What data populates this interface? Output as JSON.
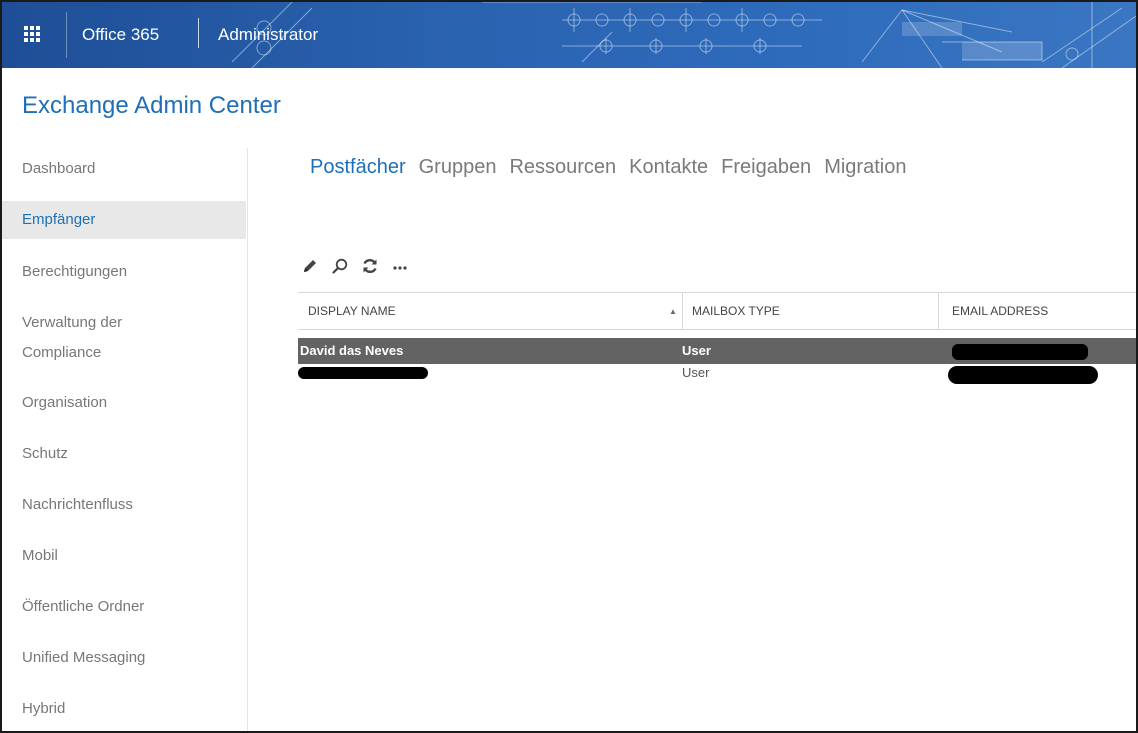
{
  "topbar": {
    "brand": "Office 365",
    "role": "Administrator"
  },
  "app_title": "Exchange Admin Center",
  "sidebar": {
    "items": [
      {
        "label": "Dashboard"
      },
      {
        "label": "Empfänger",
        "active": true
      },
      {
        "label": "Berechtigungen"
      },
      {
        "label_line1": "Verwaltung der",
        "label_line2": "Compliance"
      },
      {
        "label": "Organisation"
      },
      {
        "label": "Schutz"
      },
      {
        "label": "Nachrichtenfluss"
      },
      {
        "label": "Mobil"
      },
      {
        "label": "Öffentliche Ordner"
      },
      {
        "label": "Unified Messaging"
      },
      {
        "label": "Hybrid"
      }
    ]
  },
  "tabs": [
    {
      "label": "Postfächer",
      "active": true
    },
    {
      "label": "Gruppen"
    },
    {
      "label": "Ressourcen"
    },
    {
      "label": "Kontakte"
    },
    {
      "label": "Freigaben"
    },
    {
      "label": "Migration"
    }
  ],
  "toolbar": {
    "icons": [
      "edit-icon",
      "search-icon",
      "refresh-icon",
      "more-icon"
    ],
    "more_label": "..."
  },
  "table": {
    "columns": [
      "DISPLAY NAME",
      "MAILBOX TYPE",
      "EMAIL ADDRESS"
    ],
    "sort_indicator": "▲",
    "rows": [
      {
        "display_name": "David das Neves",
        "mailbox_type": "User",
        "selected": true
      },
      {
        "display_name": "",
        "mailbox_type": "User",
        "selected": false
      }
    ]
  },
  "colors": {
    "accent": "#1e6fb8",
    "topbar": "#2a63b0",
    "selected_row": "#636363"
  }
}
